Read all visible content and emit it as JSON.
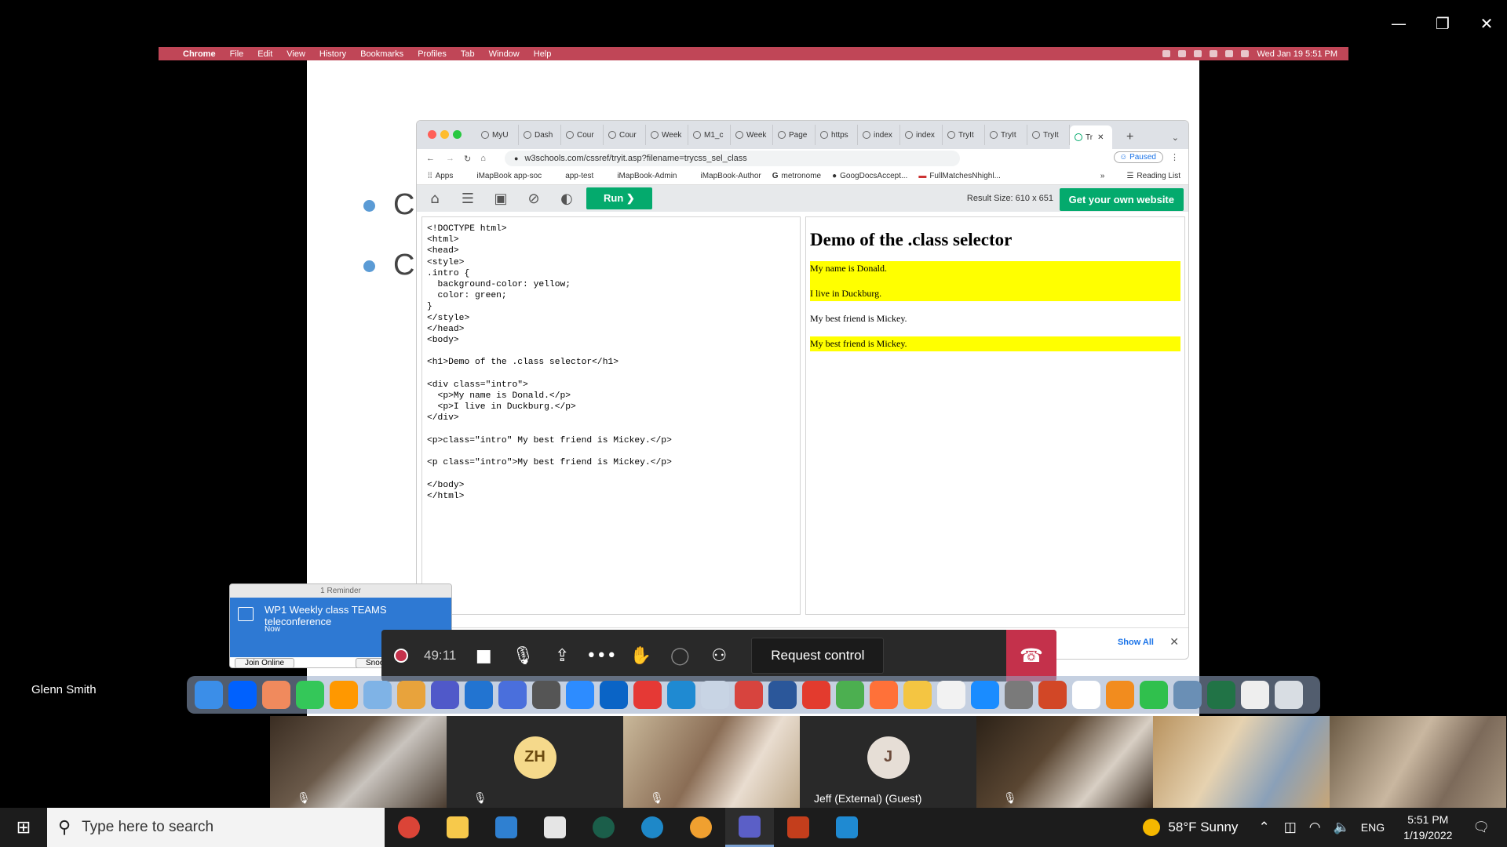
{
  "window_controls": {
    "minimize": "—",
    "maximize": "❐",
    "close": "✕"
  },
  "mac_menubar": {
    "apple_icon": "apple-icon",
    "app": "Chrome",
    "items": [
      "File",
      "Edit",
      "View",
      "History",
      "Bookmarks",
      "Profiles",
      "Tab",
      "Window",
      "Help"
    ],
    "datetime": "Wed Jan 19  5:51 PM"
  },
  "slide": {
    "bullets": [
      "C",
      "C"
    ]
  },
  "browser": {
    "tabs": [
      "MyU",
      "Dash",
      "Cour",
      "Cour",
      "Week",
      "M1_c",
      "Week",
      "Page",
      "https",
      "index",
      "index",
      "TryIt",
      "TryIt",
      "TryIt",
      "Tr"
    ],
    "url": "w3schools.com/cssref/tryit.asp?filename=trycss_sel_class",
    "profile_status": "Paused",
    "bookmarks": [
      "Apps",
      "iMapBook app-soc",
      "app-test",
      "iMapBook-Admin",
      "iMapBook-Author",
      "metronome",
      "GoogDocsAccept...",
      "FullMatchesNhighl...",
      "Reading List"
    ],
    "more_bookmarks": "»"
  },
  "tryit": {
    "run_label": "Run ❯",
    "result_size": "Result Size: 610 x 651",
    "get_website": "Get your own website",
    "code": "<!DOCTYPE html>\n<html>\n<head>\n<style>\n.intro {\n  background-color: yellow;\n  color: green;\n}\n</style>\n</head>\n<body>\n\n<h1>Demo of the .class selector</h1>\n\n<div class=\"intro\">\n  <p>My name is Donald.</p>\n  <p>I live in Duckburg.</p>\n</div>\n\n<p>class=\"intro\" My best friend is Mickey.</p>\n\n<p class=\"intro\">My best friend is Mickey.</p>\n\n</body>\n</html>",
    "result": {
      "heading": "Demo of the .class selector",
      "p1": "My name is Donald.",
      "p2": "I live in Duckburg.",
      "p3": "My best friend is Mickey.",
      "p4": "My best friend is Mickey."
    },
    "show_all": "Show All",
    "close_download": "✕"
  },
  "reminder": {
    "header": "1 Reminder",
    "subject": "WP1 Weekly class TEAMS teleconference",
    "when": "Now",
    "join": "Join Online",
    "snooze": "Snooz"
  },
  "teams": {
    "timer": "49:11",
    "request_control": "Request control",
    "presenter": "Glenn Smith",
    "participants": [
      {
        "initials": "",
        "name": ""
      },
      {
        "initials": "ZH",
        "name": ""
      },
      {
        "initials": "",
        "name": ""
      },
      {
        "initials": "J",
        "name": "Jeff (External) (Guest)"
      },
      {
        "initials": "",
        "name": ""
      },
      {
        "initials": "",
        "name": ""
      },
      {
        "initials": "",
        "name": ""
      }
    ]
  },
  "taskbar": {
    "search_placeholder": "Type here to search",
    "weather": "58°F  Sunny",
    "language": "ENG",
    "time": "5:51 PM",
    "date": "1/19/2022"
  },
  "colors": {
    "accent_green": "#04aa6d",
    "teams_red": "#c4314b",
    "mac_menubar": "#c04657",
    "highlight": "#ffff00"
  }
}
